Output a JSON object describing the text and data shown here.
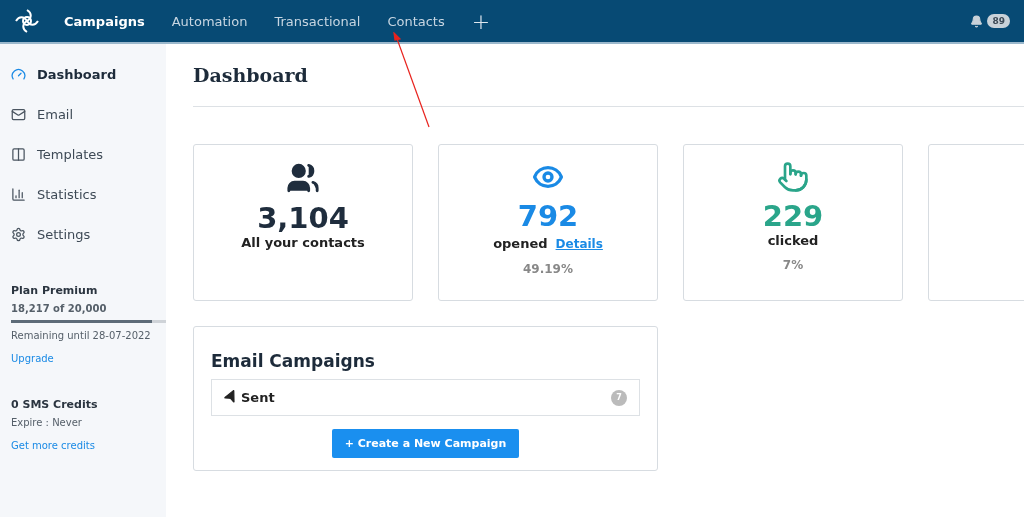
{
  "topbar": {
    "tabs": [
      {
        "label": "Campaigns",
        "selected": true
      },
      {
        "label": "Automation",
        "selected": false
      },
      {
        "label": "Transactional",
        "selected": false
      },
      {
        "label": "Contacts",
        "selected": false
      }
    ],
    "add_label": "+",
    "notifications": "89"
  },
  "sidebar": {
    "items": [
      {
        "label": "Dashboard",
        "selected": true
      },
      {
        "label": "Email",
        "selected": false
      },
      {
        "label": "Templates",
        "selected": false
      },
      {
        "label": "Statistics",
        "selected": false
      },
      {
        "label": "Settings",
        "selected": false
      }
    ],
    "plan": {
      "title": "Plan Premium",
      "usage": "18,217 of 20,000",
      "level": 0.91,
      "remaining": "Remaining until 28-07-2022",
      "link": "Upgrade"
    },
    "sms": {
      "title": "0 SMS Credits",
      "expire": "Expire : Never",
      "link": "Get more credits"
    }
  },
  "page_title": "Dashboard",
  "cards": [
    {
      "kind": "contacts",
      "value": "3,104",
      "label": "All your contacts"
    },
    {
      "kind": "opened",
      "value": "792",
      "label": "opened",
      "link": "Details",
      "percent": "49.19%"
    },
    {
      "kind": "clicked",
      "value": "229",
      "label": "clicked",
      "percent": "7%"
    },
    {
      "kind": "cut"
    }
  ],
  "campaigns": {
    "title": "Email Campaigns",
    "row": {
      "label": "Sent",
      "count": "7"
    },
    "button": "+ Create a New Campaign"
  }
}
